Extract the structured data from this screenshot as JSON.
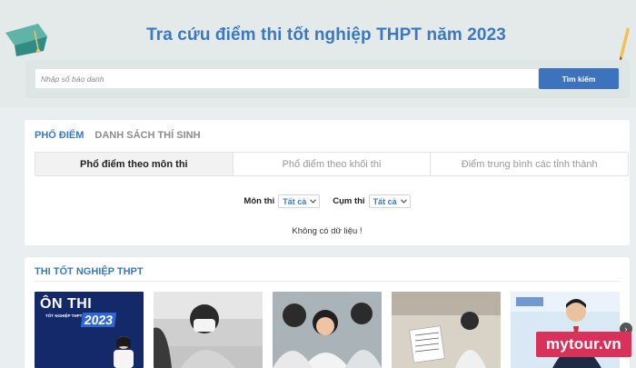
{
  "header": {
    "title": "Tra cứu điểm thi tốt nghiệp THPT năm 2023"
  },
  "search": {
    "placeholder": "Nhập số báo danh",
    "value": "",
    "button_label": "Tìm kiếm"
  },
  "main_tabs": [
    {
      "label": "PHỔ ĐIỂM",
      "active": true
    },
    {
      "label": "DANH SÁCH THÍ SINH",
      "active": false
    }
  ],
  "sub_tabs": [
    {
      "label": "Phổ điểm theo môn thi",
      "active": true
    },
    {
      "label": "Phổ điểm theo khối thi",
      "active": false
    },
    {
      "label": "Điểm trung bình các tỉnh thành",
      "active": false
    }
  ],
  "filters": {
    "subject": {
      "label": "Môn thi",
      "selected": "Tất cả"
    },
    "cluster": {
      "label": "Cụm thi",
      "selected": "Tất cả"
    }
  },
  "empty_message": "Không có dữ liệu !",
  "news_section": {
    "title": "THI TỐT NGHIỆP THPT",
    "thumbnails": [
      {
        "type": "poster",
        "headline": "ÔN THI",
        "sub": "TỐT NGHIỆP THPT",
        "year": "2023"
      },
      {
        "type": "photo",
        "icon": "student-writing-photo"
      },
      {
        "type": "photo",
        "icon": "students-smiling-photo"
      },
      {
        "type": "photo",
        "icon": "exam-room-photo"
      },
      {
        "type": "photo",
        "icon": "speaker-photo"
      }
    ]
  },
  "watermark": "mytour.vn",
  "colors": {
    "accent": "#3a78c2",
    "button": "#3d72bd",
    "watermark": "#d9315a"
  }
}
